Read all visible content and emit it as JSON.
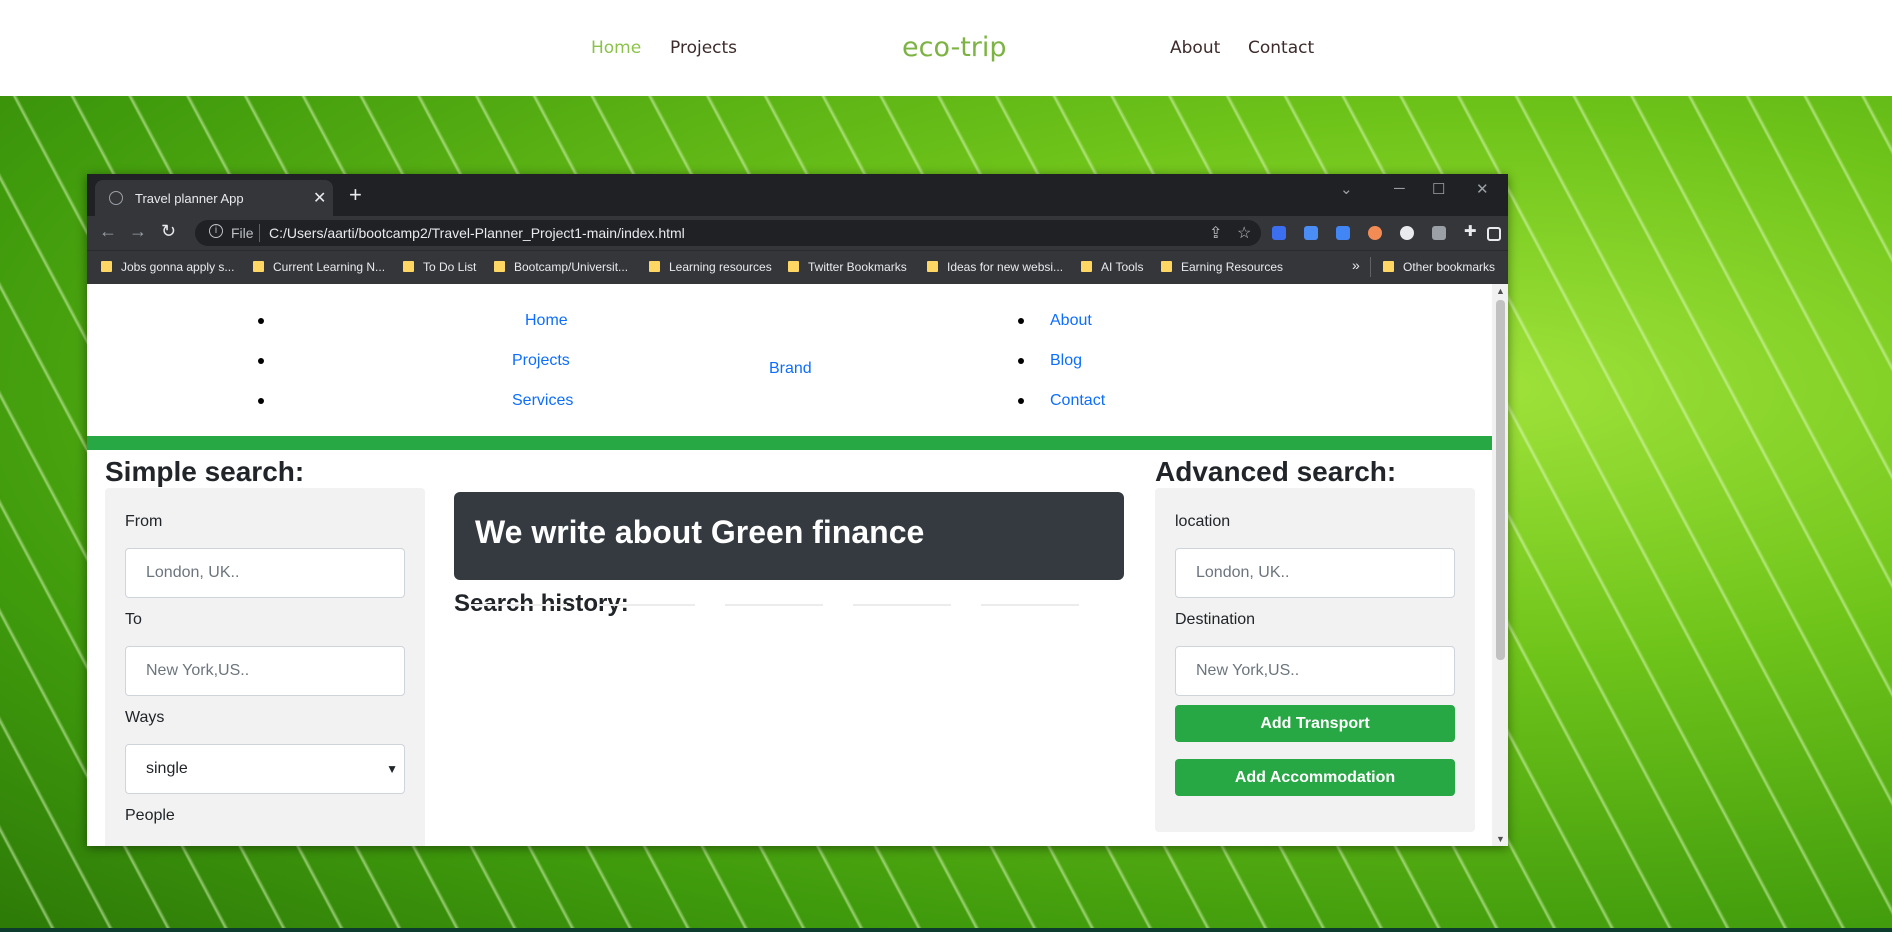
{
  "site": {
    "nav_left": [
      "Home",
      "Projects"
    ],
    "brand": "eco-trip",
    "nav_right": [
      "About",
      "Contact"
    ]
  },
  "browser": {
    "tab_title": "Travel planner App",
    "new_tab": "+",
    "url_scheme": "File",
    "url": "C:/Users/aarti/bootcamp2/Travel-Planner_Project1-main/index.html",
    "bookmarks": [
      "Jobs gonna apply s...",
      "Current Learning N...",
      "To Do List",
      "Bootcamp/Universit...",
      "Learning resources",
      "Twitter Bookmarks",
      "Ideas for new websi...",
      "AI Tools",
      "Earning Resources"
    ],
    "bookmarks_overflow": "»",
    "other_bookmarks": "Other bookmarks"
  },
  "page": {
    "nav_left": [
      "Home",
      "Projects",
      "Services"
    ],
    "brand": "Brand",
    "nav_right": [
      "About",
      "Blog",
      "Contact"
    ],
    "simple_search": {
      "heading": "Simple search:",
      "from_label": "From",
      "from_placeholder": "London, UK..",
      "to_label": "To",
      "to_placeholder": "New York,US..",
      "ways_label": "Ways",
      "ways_value": "single",
      "people_label": "People"
    },
    "hero": "We write about Green finance",
    "history_heading": "Search history:",
    "advanced_search": {
      "heading": "Advanced search:",
      "location_label": "location",
      "location_placeholder": "London, UK..",
      "destination_label": "Destination",
      "destination_placeholder": "New York,US..",
      "add_transport": "Add Transport",
      "add_accommodation": "Add Accommodation"
    }
  },
  "colors": {
    "accent_green": "#28a745",
    "link_blue": "#0d6efd",
    "hero_dark": "#343a40",
    "site_brand": "#7cb342"
  }
}
